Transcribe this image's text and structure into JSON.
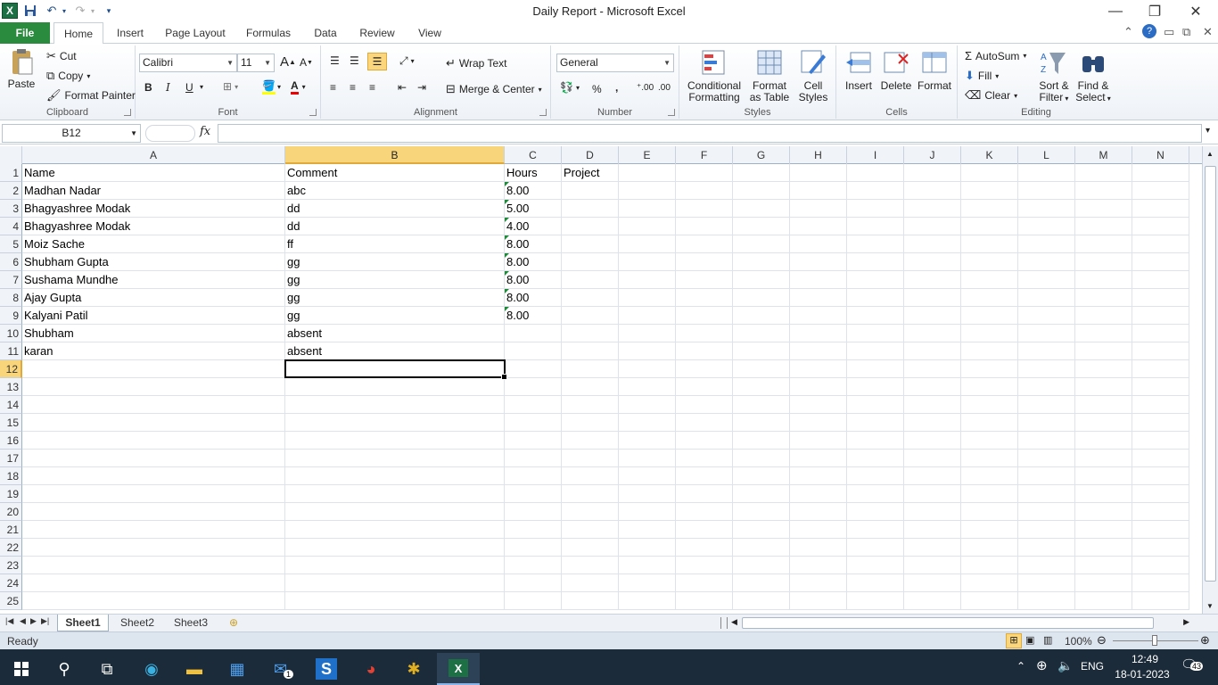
{
  "window": {
    "title": "Daily Report  -  Microsoft Excel"
  },
  "ribbon_tabs": [
    "File",
    "Home",
    "Insert",
    "Page Layout",
    "Formulas",
    "Data",
    "Review",
    "View"
  ],
  "clipboard": {
    "paste": "Paste",
    "cut": "Cut",
    "copy": "Copy",
    "format_painter": "Format Painter",
    "label": "Clipboard"
  },
  "font": {
    "name": "Calibri",
    "size": "11",
    "bold": "B",
    "italic": "I",
    "underline": "U",
    "label": "Font"
  },
  "alignment": {
    "wrap_text": "Wrap Text",
    "merge_center": "Merge & Center",
    "label": "Alignment"
  },
  "number": {
    "format": "General",
    "percent": "%",
    "comma": ",",
    "label": "Number"
  },
  "styles": {
    "conditional_1": "Conditional",
    "conditional_2": "Formatting",
    "format_table_1": "Format",
    "format_table_2": "as Table",
    "cell_styles_1": "Cell",
    "cell_styles_2": "Styles",
    "label": "Styles"
  },
  "cells": {
    "insert": "Insert",
    "delete": "Delete",
    "format": "Format",
    "label": "Cells"
  },
  "editing": {
    "autosum": "AutoSum",
    "fill": "Fill",
    "clear": "Clear",
    "sort_1": "Sort &",
    "sort_2": "Filter",
    "find_1": "Find &",
    "find_2": "Select",
    "label": "Editing"
  },
  "formula_bar": {
    "name_box": "B12",
    "fx": "fx",
    "content": ""
  },
  "columns": [
    "A",
    "B",
    "C",
    "D",
    "E",
    "F",
    "G",
    "H",
    "I",
    "J",
    "K",
    "L",
    "M",
    "N"
  ],
  "selected_cell": "B12",
  "rows": [
    {
      "num": "1",
      "A": "Name",
      "B": "Comment",
      "C": "Hours",
      "D": "Project"
    },
    {
      "num": "2",
      "A": "Madhan Nadar",
      "B": "abc",
      "C": "8.00",
      "D": ""
    },
    {
      "num": "3",
      "A": "Bhagyashree Modak",
      "B": "dd",
      "C": "5.00",
      "D": ""
    },
    {
      "num": "4",
      "A": "Bhagyashree Modak",
      "B": "dd",
      "C": "4.00",
      "D": ""
    },
    {
      "num": "5",
      "A": "Moiz Sache",
      "B": "ff",
      "C": "8.00",
      "D": ""
    },
    {
      "num": "6",
      "A": "Shubham Gupta",
      "B": "gg",
      "C": "8.00",
      "D": ""
    },
    {
      "num": "7",
      "A": "Sushama Mundhe",
      "B": "gg",
      "C": "8.00",
      "D": ""
    },
    {
      "num": "8",
      "A": "Ajay Gupta",
      "B": "gg",
      "C": "8.00",
      "D": ""
    },
    {
      "num": "9",
      "A": "Kalyani Patil",
      "B": "gg",
      "C": "8.00",
      "D": ""
    },
    {
      "num": "10",
      "A": "Shubham",
      "B": "absent",
      "C": "",
      "D": ""
    },
    {
      "num": "11",
      "A": "karan",
      "B": "absent",
      "C": "",
      "D": ""
    },
    {
      "num": "12",
      "A": "",
      "B": "",
      "C": "",
      "D": ""
    },
    {
      "num": "13",
      "A": "",
      "B": "",
      "C": "",
      "D": ""
    },
    {
      "num": "14",
      "A": "",
      "B": "",
      "C": "",
      "D": ""
    },
    {
      "num": "15",
      "A": "",
      "B": "",
      "C": "",
      "D": ""
    },
    {
      "num": "16",
      "A": "",
      "B": "",
      "C": "",
      "D": ""
    },
    {
      "num": "17",
      "A": "",
      "B": "",
      "C": "",
      "D": ""
    },
    {
      "num": "18",
      "A": "",
      "B": "",
      "C": "",
      "D": ""
    },
    {
      "num": "19",
      "A": "",
      "B": "",
      "C": "",
      "D": ""
    },
    {
      "num": "20",
      "A": "",
      "B": "",
      "C": "",
      "D": ""
    },
    {
      "num": "21",
      "A": "",
      "B": "",
      "C": "",
      "D": ""
    },
    {
      "num": "22",
      "A": "",
      "B": "",
      "C": "",
      "D": ""
    },
    {
      "num": "23",
      "A": "",
      "B": "",
      "C": "",
      "D": ""
    },
    {
      "num": "24",
      "A": "",
      "B": "",
      "C": "",
      "D": ""
    },
    {
      "num": "25",
      "A": "",
      "B": "",
      "C": "",
      "D": ""
    }
  ],
  "sheets": [
    "Sheet1",
    "Sheet2",
    "Sheet3"
  ],
  "active_sheet": "Sheet1",
  "status": {
    "ready": "Ready",
    "zoom": "100%"
  },
  "taskbar": {
    "time": "12:49",
    "date": "18-01-2023",
    "lang": "ENG",
    "notifications": "43",
    "mail_badge": "1"
  },
  "colors": {
    "file_tab": "#2a8a3e",
    "selected_header": "#f8d57a",
    "taskbar": "#1c2b3a",
    "excel_green": "#1d7044"
  }
}
